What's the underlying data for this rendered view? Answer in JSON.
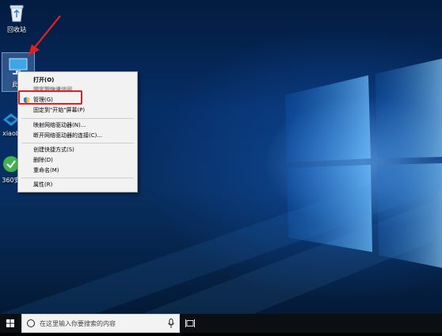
{
  "desktop": {
    "icons": [
      {
        "label": "回收站",
        "icon": "recycle-bin-icon"
      },
      {
        "label": "此电",
        "icon": "this-pc-icon"
      },
      {
        "label": "xiaob",
        "icon": "xiaobai-app-icon"
      },
      {
        "label": "360安",
        "icon": "360-security-icon"
      }
    ]
  },
  "context_menu": {
    "items": [
      {
        "label": "打开(O)"
      },
      {
        "label": "固定到快速访问"
      },
      {
        "label": "管理(G)",
        "icon": "shield-icon"
      },
      {
        "label": "固定到\"开始\"屏幕(P)"
      },
      {
        "label": "映射网络驱动器(N)..."
      },
      {
        "label": "断开网络驱动器的连接(C)..."
      },
      {
        "label": "创建快捷方式(S)"
      },
      {
        "label": "删除(D)"
      },
      {
        "label": "重命名(M)"
      },
      {
        "label": "属性(R)"
      }
    ]
  },
  "taskbar": {
    "search_placeholder": "在这里输入你要搜索的内容",
    "icons": [
      "windows-start-icon",
      "search-circle-icon",
      "microphone-icon",
      "task-view-icon"
    ]
  },
  "colors": {
    "annotation": "#e02020",
    "taskbar": "#0b0f14",
    "menu_bg": "#f2f2f2"
  }
}
